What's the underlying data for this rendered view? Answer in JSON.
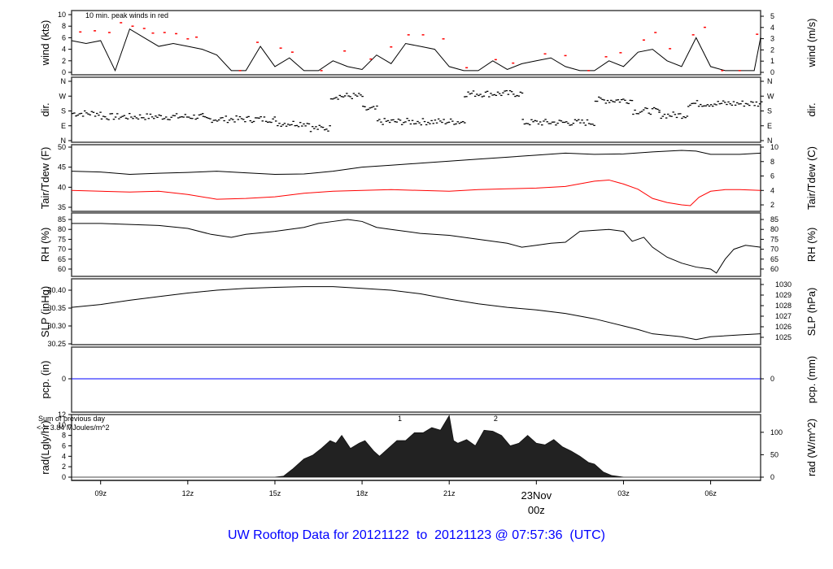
{
  "title": "UW Rooftop Data for 20121122  to  20121123 @ 07:57:36  (UTC)",
  "colors": {
    "line": "#000000",
    "peak": "#ff0000",
    "dew": "#ff0000",
    "pcp": "#0000ff",
    "annot": "#9900cc",
    "day": "#ff0000",
    "title": "#0000ff"
  },
  "chart_data": {
    "type": "line",
    "x_unit": "hours since 2012-11-22 00z",
    "xlim": [
      8.0,
      31.72
    ],
    "x_ticks": [
      {
        "h": 9,
        "label": "09z"
      },
      {
        "h": 12,
        "label": "12z"
      },
      {
        "h": 15,
        "label": "15z"
      },
      {
        "h": 18,
        "label": "18z"
      },
      {
        "h": 21,
        "label": "21z"
      },
      {
        "h": 27,
        "label": "03z"
      },
      {
        "h": 30,
        "label": "06z"
      }
    ],
    "day_marker": {
      "h": 24,
      "label1": "23Nov",
      "label2": "00z"
    },
    "panels": [
      {
        "id": "wind",
        "ylabel": "wind (kts)",
        "ylabel_right": "wind (m/s)",
        "ylim": [
          0,
          10.3
        ],
        "left_ticks": [
          0,
          2,
          4,
          6,
          8,
          10
        ],
        "right_ticks": [
          0,
          1,
          2,
          3,
          4,
          5
        ],
        "right_factor": 1.944,
        "annotation": "10 min. peak winds in red",
        "series": [
          {
            "name": "wind",
            "x": [
              8,
              8.5,
              9,
              9.5,
              10,
              10.5,
              11,
              11.5,
              12,
              12.5,
              13,
              13.5,
              14,
              14.5,
              15,
              15.5,
              16,
              16.5,
              17,
              17.5,
              18,
              18.5,
              19,
              19.5,
              20,
              20.5,
              21,
              21.5,
              22,
              22.5,
              23,
              23.5,
              24,
              24.5,
              25,
              25.5,
              26,
              26.5,
              27,
              27.5,
              28,
              28.5,
              29,
              29.5,
              30,
              30.5,
              31,
              31.5,
              31.72
            ],
            "y": [
              5.5,
              5,
              5.5,
              0.3,
              7.5,
              6,
              4.5,
              5,
              4.5,
              4,
              3,
              0.3,
              0.3,
              4.5,
              1,
              2.5,
              0.3,
              0.3,
              2,
              1,
              0.5,
              3,
              1.5,
              5,
              4.5,
              4,
              1,
              0.3,
              0.3,
              2,
              0.5,
              1.5,
              2,
              2.5,
              1,
              0.3,
              0.3,
              2,
              1,
              3.5,
              4,
              2,
              1,
              6,
              1,
              0.3,
              0.3,
              0.3,
              6
            ]
          },
          {
            "name": "peak",
            "x": [
              8.3,
              8.8,
              9.3,
              9.7,
              10.1,
              10.5,
              10.8,
              11.2,
              11.6,
              12.0,
              12.3,
              13.8,
              14.4,
              15.2,
              15.6,
              16.6,
              17.4,
              18.3,
              19.0,
              19.6,
              20.1,
              20.8,
              21.6,
              22.6,
              23.2,
              24.3,
              25.0,
              25.8,
              26.4,
              26.9,
              27.7,
              28.1,
              28.6,
              29.4,
              29.8,
              30.4,
              31.0,
              31.6
            ],
            "y": [
              7,
              7.2,
              6.9,
              8.6,
              8,
              7.6,
              6.8,
              6.9,
              6.7,
              5.8,
              6.1,
              0.3,
              5.2,
              4.2,
              3.5,
              0.3,
              3.7,
              2.3,
              4.4,
              6.5,
              6.5,
              5.8,
              0.8,
              2.2,
              1.6,
              3.2,
              2.9,
              0.3,
              2.7,
              3.4,
              5.6,
              6.9,
              4.1,
              6.5,
              7.8,
              0.3,
              0.3,
              6.6
            ]
          }
        ]
      },
      {
        "id": "dir",
        "ylabel": "dir.",
        "ylabel_right": "dir.",
        "ylim": [
          0,
          360
        ],
        "left_tick_labels": [
          {
            "v": 0,
            "l": "N"
          },
          {
            "v": 90,
            "l": "E"
          },
          {
            "v": 180,
            "l": "S"
          },
          {
            "v": 270,
            "l": "W"
          },
          {
            "v": 360,
            "l": "N"
          }
        ],
        "segments": [
          [
            8,
            9,
            165
          ],
          [
            9,
            12.5,
            145
          ],
          [
            12.5,
            15,
            130
          ],
          [
            15,
            16.2,
            105
          ],
          [
            16.2,
            16.9,
            75
          ],
          [
            16.9,
            18,
            270
          ],
          [
            18,
            18.5,
            190
          ],
          [
            18.5,
            21.5,
            115
          ],
          [
            21.5,
            23.5,
            285
          ],
          [
            23.5,
            26,
            110
          ],
          [
            26,
            27.3,
            245
          ],
          [
            27.3,
            28.2,
            180
          ],
          [
            28.2,
            29.2,
            155
          ],
          [
            29.2,
            31.72,
            225
          ]
        ]
      },
      {
        "id": "temp",
        "ylabel": "Tair/Tdew (F)",
        "ylabel_right": "Tair/Tdew (C)",
        "ylim": [
          34.8,
          50.3
        ],
        "left_ticks": [
          35,
          40,
          45,
          50
        ],
        "right_ticks": [
          2,
          4,
          6,
          8,
          10
        ],
        "right_kind": "C",
        "series": [
          {
            "name": "Tair",
            "x": [
              8,
              9,
              10,
              11,
              12,
              13,
              14,
              15,
              16,
              17,
              18,
              19,
              20,
              21,
              22,
              23,
              24,
              25,
              26,
              27,
              28,
              29,
              29.5,
              30,
              31,
              31.72
            ],
            "y": [
              44,
              43.8,
              43.2,
              43.5,
              43.7,
              44,
              43.6,
              43.2,
              43.3,
              44,
              45,
              45.5,
              46,
              46.5,
              47,
              47.5,
              48,
              48.5,
              48.2,
              48.3,
              48.8,
              49.2,
              49,
              48.2,
              48.2,
              48.5
            ]
          },
          {
            "name": "Tdew",
            "x": [
              8,
              9,
              10,
              11,
              12,
              13,
              14,
              15,
              16,
              17,
              18,
              19,
              20,
              21,
              22,
              23,
              24,
              25,
              26,
              26.5,
              27,
              27.5,
              28,
              28.5,
              29,
              29.3,
              29.6,
              30,
              30.5,
              31,
              31.72
            ],
            "y": [
              39.2,
              39,
              38.8,
              39,
              38.2,
              37,
              37.2,
              37.6,
              38.5,
              39,
              39.2,
              39.4,
              39.2,
              39,
              39.4,
              39.6,
              39.8,
              40.2,
              41.5,
              41.8,
              40.8,
              39.5,
              37.2,
              36.2,
              35.6,
              35.4,
              37.5,
              39,
              39.4,
              39.4,
              39.2
            ]
          }
        ]
      },
      {
        "id": "rh",
        "ylabel": "RH (%)",
        "ylabel_right": "RH (%)",
        "ylim": [
          57,
          87
        ],
        "left_ticks": [
          60,
          65,
          70,
          75,
          80,
          85
        ],
        "right_ticks": [
          60,
          65,
          70,
          75,
          80,
          85
        ],
        "series": [
          {
            "name": "RH",
            "x": [
              8,
              9,
              10,
              11,
              12,
              12.8,
              13.5,
              14,
              15,
              16,
              16.5,
              17,
              17.5,
              18,
              18.5,
              19,
              20,
              21,
              22,
              23,
              23.5,
              24,
              24.5,
              25,
              25.5,
              26,
              26.5,
              27,
              27.3,
              27.7,
              28,
              28.5,
              29,
              29.5,
              30,
              30.2,
              30.5,
              30.8,
              31.2,
              31.72
            ],
            "y": [
              83,
              83,
              82.5,
              82,
              80.5,
              77.5,
              76,
              77.5,
              79,
              81,
              83,
              84,
              85,
              84,
              81,
              80,
              78,
              77,
              75,
              73,
              71,
              72,
              73,
              73.5,
              79,
              79.5,
              80,
              79,
              74,
              76,
              71,
              66,
              63,
              61,
              60,
              58,
              65,
              70,
              72,
              71
            ]
          }
        ]
      },
      {
        "id": "slp",
        "ylabel": "SLP (inHg)",
        "ylabel_right": "SLP (hPa)",
        "ylim": [
          30.25,
          30.43
        ],
        "left_ticks": [
          30.25,
          30.3,
          30.35,
          30.4
        ],
        "right_ticks": [
          1025,
          1026,
          1027,
          1028,
          1029,
          1030
        ],
        "right_factor_hpa": 0.02953,
        "series": [
          {
            "name": "SLP",
            "x": [
              8,
              9,
              10,
              11,
              12,
              13,
              14,
              15,
              16,
              17,
              18,
              19,
              20,
              21,
              22,
              23,
              24,
              25,
              26,
              27,
              27.5,
              28,
              29,
              29.5,
              30,
              31,
              31.72
            ],
            "y": [
              30.352,
              30.36,
              30.372,
              30.382,
              30.392,
              30.4,
              30.405,
              30.408,
              30.41,
              30.41,
              30.405,
              30.4,
              30.39,
              30.375,
              30.362,
              30.352,
              30.345,
              30.335,
              30.32,
              30.3,
              30.29,
              30.278,
              30.27,
              30.262,
              30.27,
              30.275,
              30.278
            ]
          }
        ]
      },
      {
        "id": "pcp",
        "ylabel": "pcp. (in)",
        "ylabel_right": "pcp. (mm)",
        "ylim": [
          -1,
          1
        ],
        "left_ticks": [
          0
        ],
        "right_ticks": [
          0
        ],
        "series": [
          {
            "name": "pcp",
            "x": [
              8,
              31.72
            ],
            "y": [
              0,
              0
            ]
          }
        ]
      },
      {
        "id": "rad",
        "ylabel": "rad(Lgly/hr)",
        "ylabel_right": "rad (W/m^2)",
        "ylim": [
          0,
          12.2
        ],
        "left_ticks": [
          0,
          2,
          4,
          6,
          8,
          10,
          12
        ],
        "right_ticks": [
          0,
          50,
          100
        ],
        "right_factor": 0.086,
        "annotation_line1": "Sum of previous day",
        "annotation_line2": "<--- 3.84 MJoules/m^2",
        "marks": [
          {
            "h": 19.3,
            "label": "1"
          },
          {
            "h": 22.6,
            "label": "2"
          }
        ],
        "series": [
          {
            "name": "rad",
            "x": [
              8,
              15,
              15.3,
              15.6,
              16,
              16.3,
              16.6,
              16.9,
              17.1,
              17.3,
              17.6,
              17.9,
              18.1,
              18.4,
              18.6,
              18.9,
              19.2,
              19.5,
              19.8,
              20.1,
              20.4,
              20.7,
              21.0,
              21.15,
              21.3,
              21.6,
              21.9,
              22.2,
              22.5,
              22.8,
              23.1,
              23.4,
              23.7,
              24.0,
              24.3,
              24.6,
              24.9,
              25.2,
              25.5,
              25.8,
              26.0,
              26.3,
              26.6,
              27,
              31.72
            ],
            "y": [
              0,
              0,
              0.2,
              1.5,
              3.5,
              4.2,
              5.5,
              7,
              6.5,
              8,
              5.5,
              6.5,
              7,
              5,
              4,
              5.5,
              7,
              7,
              8.5,
              8.5,
              9.5,
              9,
              11.8,
              7,
              6.5,
              7.2,
              6,
              9,
              8.8,
              8,
              6,
              6.5,
              8,
              6.5,
              6.2,
              7.2,
              5.8,
              5,
              4,
              2.8,
              2.5,
              1,
              0.3,
              0,
              0
            ]
          }
        ]
      }
    ]
  }
}
